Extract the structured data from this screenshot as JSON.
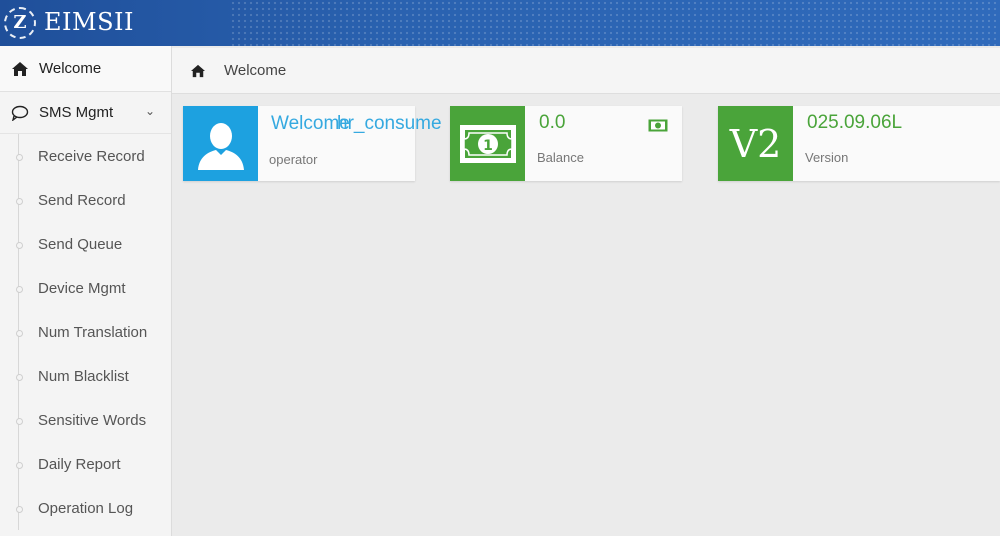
{
  "app": {
    "logo_text": "Z",
    "title": "EIMSII"
  },
  "sidebar": {
    "welcome_label": "Welcome",
    "sms_group_label": "SMS Mgmt",
    "items": [
      {
        "label": "Receive Record"
      },
      {
        "label": "Send Record"
      },
      {
        "label": "Send Queue"
      },
      {
        "label": "Device Mgmt"
      },
      {
        "label": "Num Translation"
      },
      {
        "label": "Num Blacklist"
      },
      {
        "label": "Sensitive Words"
      },
      {
        "label": "Daily Report"
      },
      {
        "label": "Operation Log"
      }
    ]
  },
  "breadcrumb": {
    "label": "Welcome"
  },
  "cards": {
    "user": {
      "welcome": "Welcome",
      "name": "hr_consume",
      "caption": "operator"
    },
    "balance": {
      "value": "0.0",
      "caption": "Balance"
    },
    "version": {
      "tile": "V2",
      "value": "025.09.06L",
      "caption": "Version"
    }
  },
  "colors": {
    "header": "#2a62b0",
    "user_tile": "#1da1e0",
    "green": "#4aa43a"
  }
}
